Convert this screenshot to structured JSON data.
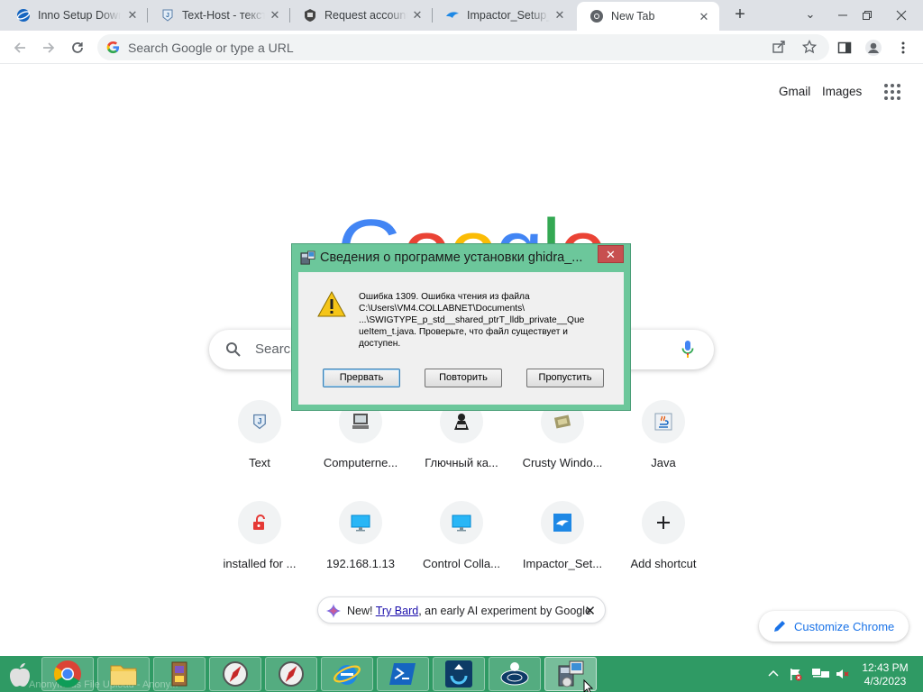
{
  "browser": {
    "tabs": [
      {
        "title": "Inno Setup Down",
        "icon": "inno-setup-favicon",
        "active": false
      },
      {
        "title": "Text-Host - текстовый",
        "icon": "text-host-favicon",
        "active": false
      },
      {
        "title": "Request account",
        "icon": "computerneo-favicon",
        "active": false
      },
      {
        "title": "Impactor_Setup_",
        "icon": "impactor-favicon",
        "active": false
      },
      {
        "title": "New Tab",
        "icon": "chrome-favicon",
        "active": true
      }
    ],
    "new_tab_symbol": "+",
    "window_controls": {
      "minimize": "—",
      "restore": "❐",
      "close": "✕",
      "tab_search": "⌄"
    },
    "omnibox": {
      "placeholder": "Search Google or type a URL",
      "value": ""
    }
  },
  "ntp": {
    "gmail_label": "Gmail",
    "images_label": "Images",
    "logo_text": "Google",
    "logo_colors": [
      "#4285f4",
      "#ea4335",
      "#fbbc05",
      "#4285f4",
      "#34a853",
      "#ea4335"
    ],
    "search_placeholder": "Search Google or type a URL",
    "shortcuts": [
      {
        "label": "Text",
        "icon": "text-host-icon"
      },
      {
        "label": "Computerne...",
        "icon": "computer-icon"
      },
      {
        "label": "Глючный ка...",
        "icon": "hacker-icon"
      },
      {
        "label": "Crusty Windo...",
        "icon": "crusty-windows-icon"
      },
      {
        "label": "Java",
        "icon": "java-icon"
      },
      {
        "label": "installed for ...",
        "icon": "unlocked-lock-icon"
      },
      {
        "label": "192.168.1.13",
        "icon": "monitor-icon"
      },
      {
        "label": "Control Colla...",
        "icon": "monitor-icon"
      },
      {
        "label": "Impactor_Set...",
        "icon": "impactor-icon"
      },
      {
        "label": "Add shortcut",
        "icon": "plus-icon"
      }
    ],
    "bard": {
      "prefix": "New!",
      "link": "Try Bard",
      "suffix": ", an early AI experiment by Google",
      "close": "✕"
    },
    "customize_label": "Customize Chrome"
  },
  "dialog": {
    "title": "Сведения о программе установки ghidra_...",
    "close_symbol": "✕",
    "message": "Ошибка 1309. Ошибка чтения из файла\nC:\\Users\\VM4.COLLABNET\\Documents\\\n...\\SWIGTYPE_p_std__shared_ptrT_lldb_private__Que\nueItem_t.java.   Проверьте, что файл существует и\nдоступен.",
    "buttons": {
      "abort": "Прервать",
      "retry": "Повторить",
      "ignore": "Пропустить"
    },
    "accent_color": "#6cc79b"
  },
  "taskbar": {
    "ghost_text": "Anonymous File Upload - Anony...",
    "items": [
      "apple-icon",
      "chrome-icon",
      "file-explorer-icon",
      "installer-package-icon",
      "compass-icon",
      "compass-icon",
      "ie-icon",
      "powershell-icon",
      "upload-icon",
      "disc-icon",
      "installer-setup-icon"
    ],
    "time": "12:43 PM",
    "date": "4/3/2023",
    "color": "#2f9a64"
  }
}
